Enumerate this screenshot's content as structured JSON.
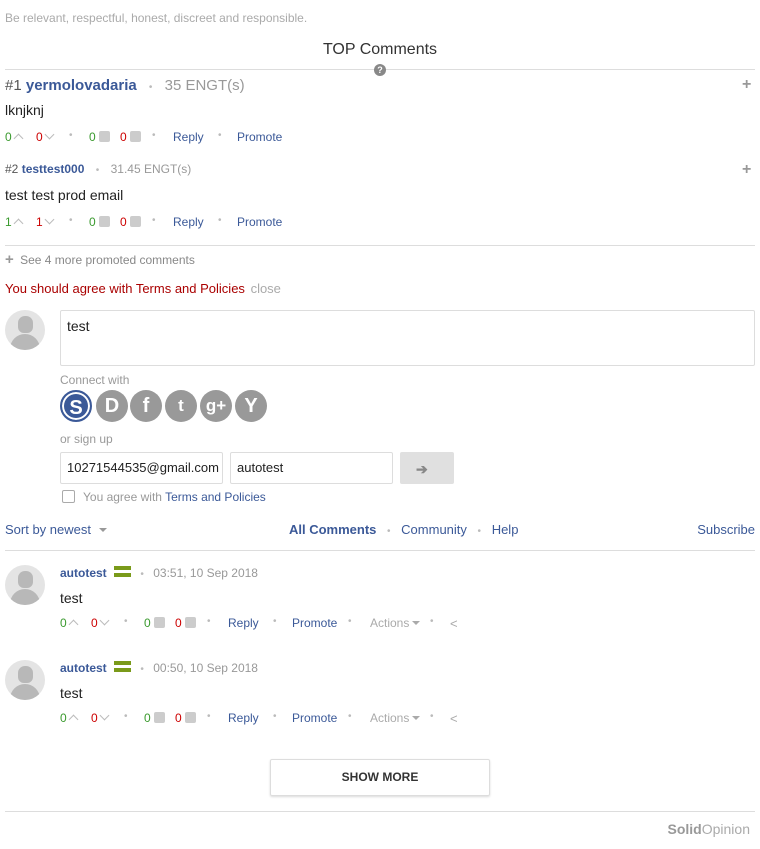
{
  "guidelines": "Be relevant, respectful, honest, discreet and responsible.",
  "top_comments": {
    "heading": "TOP Comments",
    "items": [
      {
        "rank": "#1",
        "author": "yermolovadaria",
        "amount": "35 ENGT(s)",
        "text": "lknjknj",
        "up": "0",
        "down": "0",
        "likes": "0",
        "dislikes": "0",
        "reply": "Reply",
        "promote": "Promote"
      },
      {
        "rank": "#2",
        "author": "testtest000",
        "amount": "31.45 ENGT(s)",
        "text": "test test prod email",
        "up": "1",
        "down": "1",
        "likes": "0",
        "dislikes": "0",
        "reply": "Reply",
        "promote": "Promote"
      }
    ],
    "see_more": "See 4 more promoted comments"
  },
  "terms_warning": {
    "text": "You should agree with Terms and Policies",
    "close": "close"
  },
  "composer": {
    "text": "test",
    "connect_with": "Connect with",
    "social": [
      "S",
      "D",
      "f",
      "t",
      "g+",
      "Y"
    ],
    "or_sign_up": "or sign up",
    "email": "10271544535@gmail.com",
    "username": "autotest",
    "agree_prefix": "You agree with",
    "agree_link": "Terms and Policies"
  },
  "toolbar": {
    "sort": "Sort by newest",
    "tabs": [
      "All Comments",
      "Community",
      "Help"
    ],
    "subscribe": "Subscribe"
  },
  "comments": [
    {
      "author": "autotest",
      "time": "03:51, 10 Sep 2018",
      "text": "test",
      "up": "0",
      "down": "0",
      "likes": "0",
      "dislikes": "0",
      "reply": "Reply",
      "promote": "Promote",
      "actions": "Actions"
    },
    {
      "author": "autotest",
      "time": "00:50, 10 Sep 2018",
      "text": "test",
      "up": "0",
      "down": "0",
      "likes": "0",
      "dislikes": "0",
      "reply": "Reply",
      "promote": "Promote",
      "actions": "Actions"
    }
  ],
  "show_more": "SHOW MORE",
  "brand": {
    "solid": "Solid",
    "opinion": "Opinion"
  },
  "colors": {
    "link": "#3b5998",
    "up": "#3a9a2e",
    "down": "#cc0000",
    "badge": "#7a9a1a",
    "warning": "#aa0000"
  },
  "icons": {
    "help": "question-circle-icon",
    "expand": "plus-icon",
    "share": "share-icon",
    "submit": "arrow-right-icon"
  }
}
